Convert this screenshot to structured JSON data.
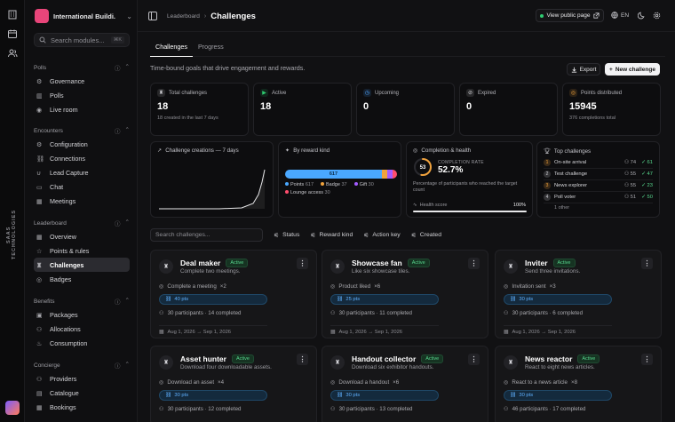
{
  "rail": {
    "vertical_text": "SAAS TECHNOLOGIES"
  },
  "org": {
    "name": "International Buildi..."
  },
  "sidebar": {
    "search_placeholder": "Search modules...",
    "search_shortcut": "⌘K",
    "groups": [
      {
        "title": "Polls",
        "items": [
          {
            "label": "Governance",
            "icon": "gear-icon"
          },
          {
            "label": "Polls",
            "icon": "chart-icon"
          },
          {
            "label": "Live room",
            "icon": "radio-icon"
          }
        ]
      },
      {
        "title": "Encounters",
        "items": [
          {
            "label": "Configuration",
            "icon": "gear-icon"
          },
          {
            "label": "Connections",
            "icon": "link-icon"
          },
          {
            "label": "Lead Capture",
            "icon": "magnet-icon"
          },
          {
            "label": "Chat",
            "icon": "chat-icon"
          },
          {
            "label": "Meetings",
            "icon": "calendar-icon"
          }
        ]
      },
      {
        "title": "Leaderboard",
        "items": [
          {
            "label": "Overview",
            "icon": "grid-icon"
          },
          {
            "label": "Points & rules",
            "icon": "star-icon"
          },
          {
            "label": "Challenges",
            "icon": "trophy-icon",
            "active": true
          },
          {
            "label": "Badges",
            "icon": "badge-icon"
          }
        ]
      },
      {
        "title": "Benefits",
        "items": [
          {
            "label": "Packages",
            "icon": "box-icon"
          },
          {
            "label": "Allocations",
            "icon": "users-icon"
          },
          {
            "label": "Consumption",
            "icon": "flame-icon"
          }
        ]
      },
      {
        "title": "Concierge",
        "items": [
          {
            "label": "Providers",
            "icon": "users-icon"
          },
          {
            "label": "Catalogue",
            "icon": "book-icon"
          },
          {
            "label": "Bookings",
            "icon": "calendar-icon"
          }
        ]
      }
    ]
  },
  "topbar": {
    "breadcrumb_parent": "Leaderboard",
    "breadcrumb_sep": "›",
    "title": "Challenges",
    "public_page": "View public page",
    "language": "EN"
  },
  "tabs": [
    {
      "label": "Challenges",
      "active": true
    },
    {
      "label": "Progress",
      "active": false
    }
  ],
  "subtitle": "Time-bound goals that drive engagement and rewards.",
  "buttons": {
    "export": "Export",
    "new_challenge": "New challenge"
  },
  "stats": [
    {
      "label": "Total challenges",
      "value": "18",
      "sub": "18 created in the last 7 days",
      "icon": "trophy-icon",
      "color": "#cfcfd4"
    },
    {
      "label": "Active",
      "value": "18",
      "sub": "",
      "icon": "play-icon",
      "color": "#2ecc71"
    },
    {
      "label": "Upcoming",
      "value": "0",
      "sub": "",
      "icon": "clock-icon",
      "color": "#4ea3ff"
    },
    {
      "label": "Expired",
      "value": "0",
      "sub": "",
      "icon": "expired-icon",
      "color": "#cfcfd4"
    },
    {
      "label": "Points distributed",
      "value": "15945",
      "sub": "376 completions total",
      "icon": "coins-icon",
      "color": "#f0a23c"
    }
  ],
  "creations": {
    "title": "Challenge creations — 7 days"
  },
  "reward_kind": {
    "title": "By reward kind",
    "bar_label": "617",
    "segments": [
      {
        "name": "Points",
        "value": 617,
        "color": "#4aa8ff"
      },
      {
        "name": "Badge",
        "value": 37,
        "color": "#f0a23c"
      },
      {
        "name": "Gift",
        "value": 30,
        "color": "#a35cff"
      },
      {
        "name": "Lounge access",
        "value": 30,
        "color": "#ff4d6d"
      }
    ],
    "legend": [
      {
        "name": "Points",
        "value": "617",
        "color": "#4aa8ff"
      },
      {
        "name": "Badge",
        "value": "37",
        "color": "#f0a23c"
      },
      {
        "name": "Gift",
        "value": "30",
        "color": "#a35cff"
      },
      {
        "name": "Lounge access",
        "value": "30",
        "color": "#ff4d6d"
      }
    ]
  },
  "health": {
    "title": "Completion & health",
    "score": "53",
    "rate_label": "COMPLETION RATE",
    "rate": "52.7%",
    "rate_fraction": 0.527,
    "desc": "Percentage of participants who reached the target count",
    "health_label": "Health score",
    "health_value": "100%",
    "health_fraction": 1.0
  },
  "top": {
    "title": "Top challenges",
    "rows": [
      {
        "rank": "1",
        "name": "On-site arrival",
        "participants": "74",
        "completed": "61"
      },
      {
        "rank": "2",
        "name": "Test challenge",
        "participants": "55",
        "completed": "47"
      },
      {
        "rank": "3",
        "name": "News explorer",
        "participants": "55",
        "completed": "23"
      },
      {
        "rank": "4",
        "name": "Poll voter",
        "participants": "51",
        "completed": "50"
      }
    ],
    "footer": "1 other"
  },
  "filters": {
    "search_placeholder": "Search challenges...",
    "status": "Status",
    "reward": "Reward kind",
    "action": "Action key",
    "created": "Created"
  },
  "cards": [
    {
      "title": "Deal maker",
      "desc": "Complete two meetings.",
      "status": "Active",
      "action": "Complete a meeting",
      "count": "×2",
      "points": "40 pts",
      "participants": "30 participants · 14 completed",
      "dates": "Aug 1, 2026 → Sep 1, 2026"
    },
    {
      "title": "Showcase fan",
      "desc": "Like six showcase tiles.",
      "status": "Active",
      "action": "Product liked",
      "count": "×6",
      "points": "25 pts",
      "participants": "30 participants · 11 completed",
      "dates": "Aug 1, 2026 → Sep 1, 2026"
    },
    {
      "title": "Inviter",
      "desc": "Send three invitations.",
      "status": "Active",
      "action": "Invitation sent",
      "count": "×3",
      "points": "30 pts",
      "participants": "30 participants · 6 completed",
      "dates": "Aug 1, 2026 → Sep 1, 2026"
    },
    {
      "title": "Asset hunter",
      "desc": "Download four downloadable assets.",
      "status": "Active",
      "action": "Download an asset",
      "count": "×4",
      "points": "30 pts",
      "participants": "30 participants · 12 completed",
      "dates": ""
    },
    {
      "title": "Handout collector",
      "desc": "Download six exhibitor handouts.",
      "status": "Active",
      "action": "Download a handout",
      "count": "×6",
      "points": "30 pts",
      "participants": "30 participants · 13 completed",
      "dates": ""
    },
    {
      "title": "News reactor",
      "desc": "React to eight news articles.",
      "status": "Active",
      "action": "React to a news article",
      "count": "×8",
      "points": "30 pts",
      "participants": "46 participants · 17 completed",
      "dates": ""
    }
  ]
}
